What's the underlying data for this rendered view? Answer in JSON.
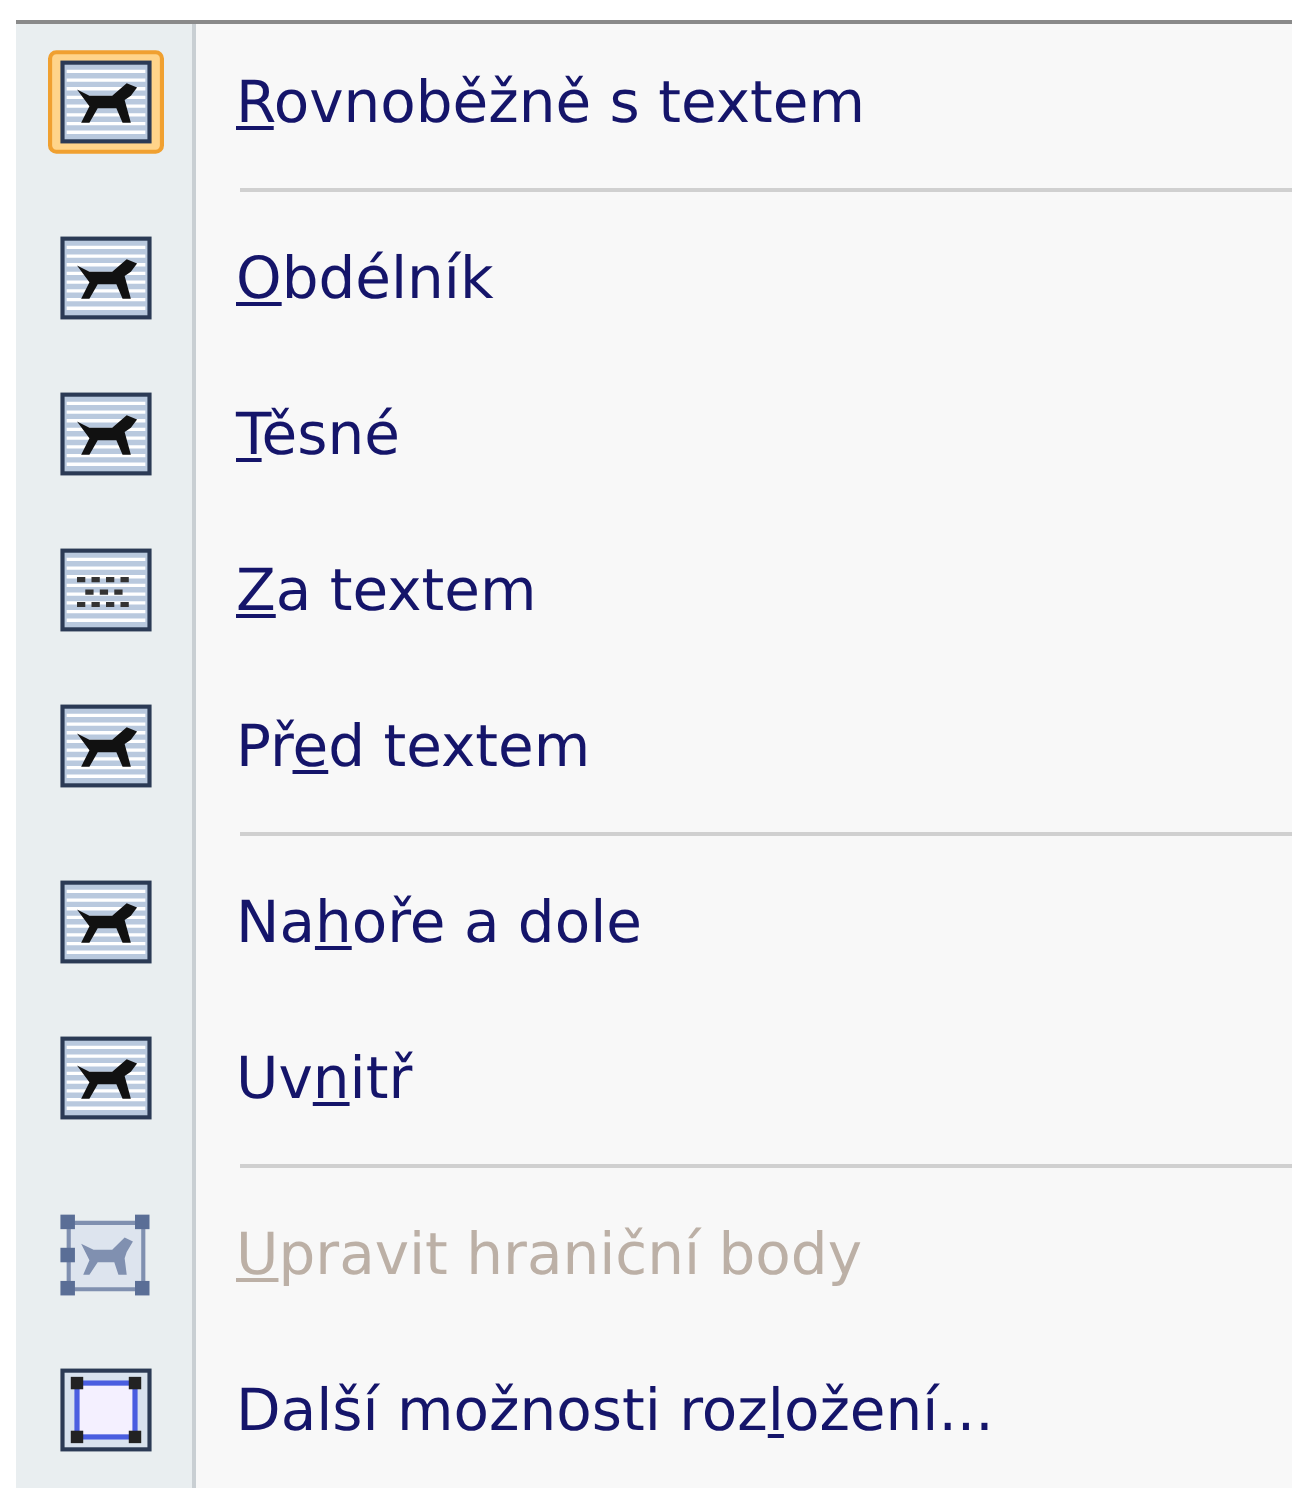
{
  "menu": {
    "groups": [
      [
        {
          "kind": "wrap",
          "selected": true,
          "disabled": false,
          "key": "R",
          "after": "ovnoběžně s textem"
        }
      ],
      [
        {
          "kind": "wrap",
          "selected": false,
          "disabled": false,
          "key": "O",
          "after": "bdélník"
        },
        {
          "kind": "wrap",
          "selected": false,
          "disabled": false,
          "key": "T",
          "after": "ěsné"
        },
        {
          "kind": "behind",
          "selected": false,
          "disabled": false,
          "key": "Z",
          "after": "a textem"
        },
        {
          "kind": "wrap",
          "selected": false,
          "disabled": false,
          "before": "Př",
          "key": "e",
          "after": "d textem"
        }
      ],
      [
        {
          "kind": "wrap",
          "selected": false,
          "disabled": false,
          "before": "Na",
          "key": "h",
          "after": "oře a dole"
        },
        {
          "kind": "wrap",
          "selected": false,
          "disabled": false,
          "before": "Uv",
          "key": "n",
          "after": "itř"
        }
      ],
      [
        {
          "kind": "points",
          "selected": false,
          "disabled": true,
          "key": "U",
          "after": "pravit hraniční body"
        },
        {
          "kind": "more",
          "selected": false,
          "disabled": false,
          "before": "Další možnosti roz",
          "key": "l",
          "after": "ožení..."
        }
      ]
    ]
  }
}
